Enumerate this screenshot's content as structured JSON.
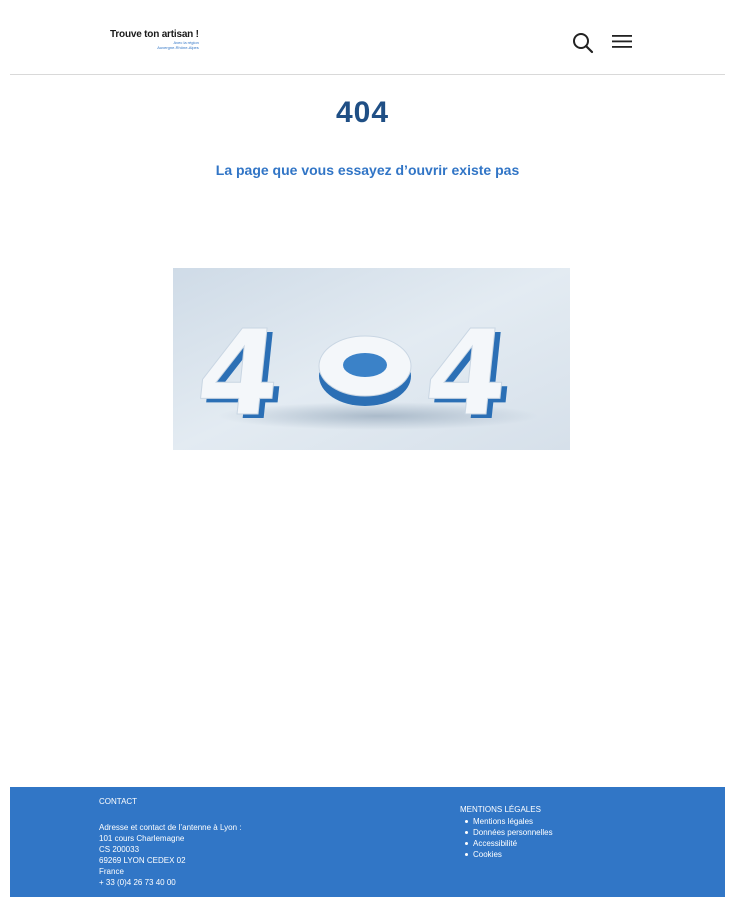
{
  "header": {
    "logo_main": "Trouve ton artisan !",
    "logo_sub1": "Avec la région",
    "logo_sub2": "Auvergne-Rhône-Alpes",
    "search_icon": "search-icon",
    "menu_icon": "hamburger-menu-icon"
  },
  "main": {
    "error_code": "404",
    "error_message": "La page que vous essayez d’ouvrir existe pas",
    "image_digits": [
      "4",
      "0",
      "4"
    ]
  },
  "footer": {
    "contact_title": "CONTACT",
    "contact_lines": [
      "Adresse et contact de l’antenne à Lyon :",
      "101 cours Charlemagne",
      "CS 200033",
      "69269 LYON CEDEX 02",
      "France",
      "+ 33 (0)4 26 73 40 00"
    ],
    "legal_title": "MENTIONS LÉGALES",
    "legal_links": [
      "Mentions légales",
      "Données personnelles",
      "Accessibilité",
      "Cookies"
    ]
  },
  "colors": {
    "brand_blue": "#3176c6",
    "title_dark_blue": "#1f4f85",
    "image_bg": "#dce5ee"
  }
}
